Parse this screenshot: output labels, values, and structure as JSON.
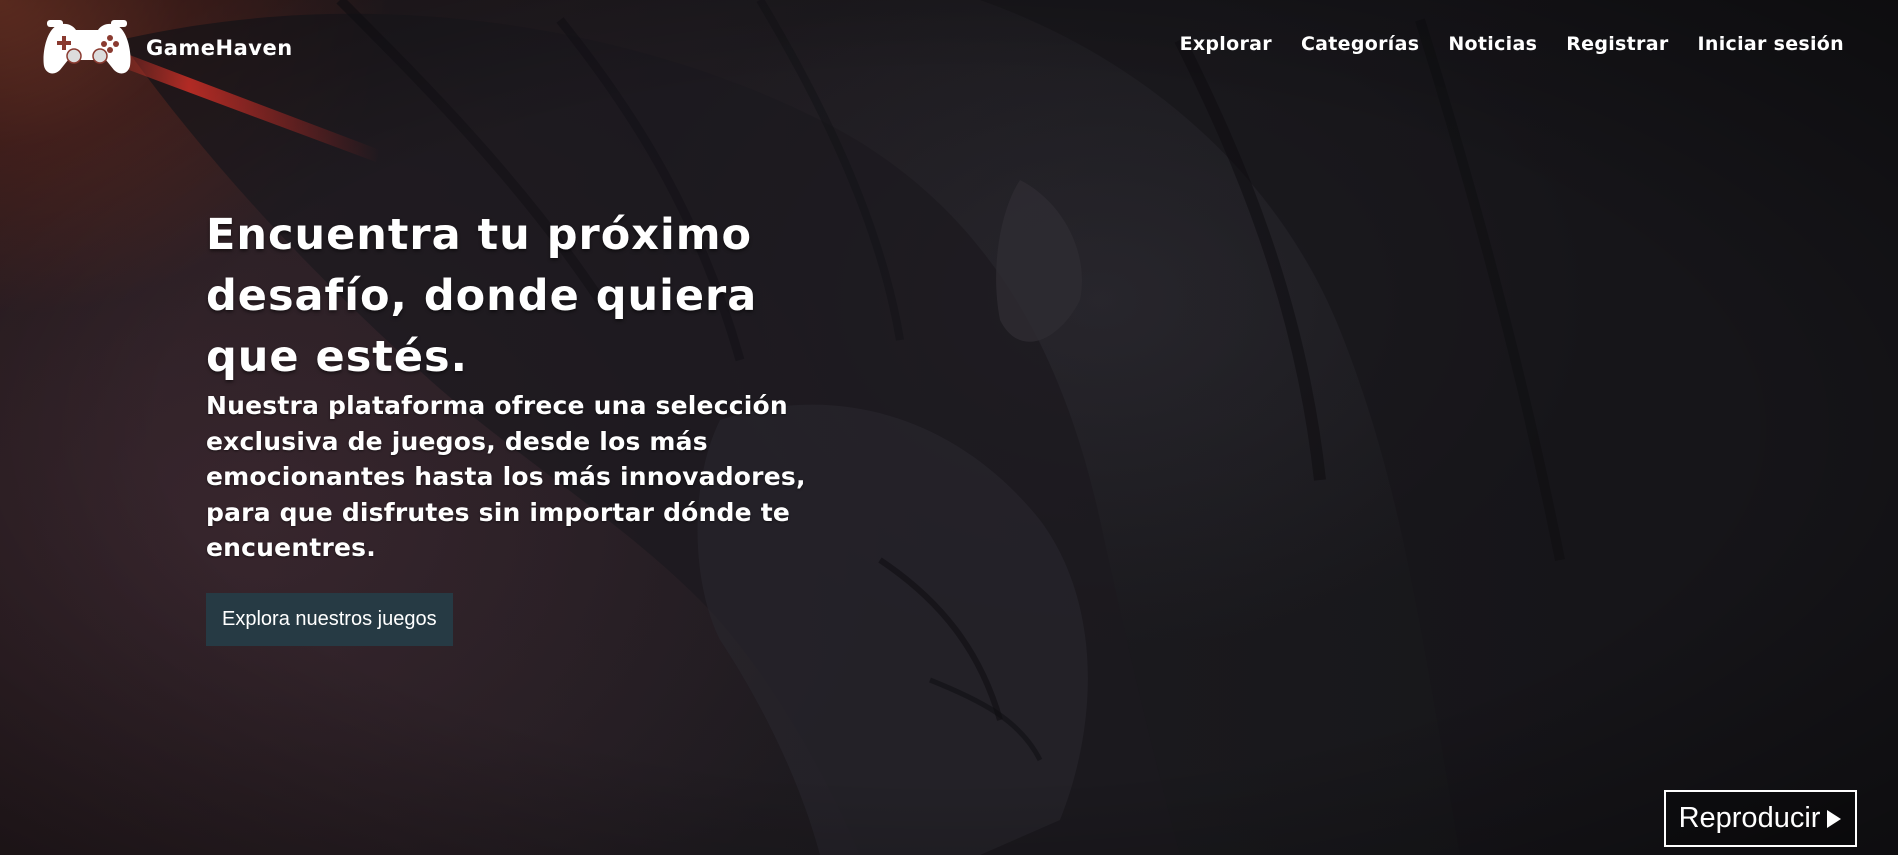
{
  "brand": {
    "name": "GameHaven",
    "logo_icon": "gamepad-icon"
  },
  "nav": {
    "items": [
      {
        "label": "Explorar"
      },
      {
        "label": "Categorías"
      },
      {
        "label": "Noticias"
      },
      {
        "label": "Registrar"
      },
      {
        "label": "Iniciar sesión"
      }
    ]
  },
  "hero": {
    "headline": "Encuentra tu próximo desafío, donde quiera que estés.",
    "subtext": "Nuestra plataforma ofrece una selección exclusiva de juegos, desde los más emocionantes hasta los más innovadores, para que disfrutes sin importar dónde te encuentres.",
    "cta_label": "Explora nuestros juegos",
    "play_label": "Reproducir",
    "play_icon": "play-icon"
  },
  "colors": {
    "cta_background": "#263a44",
    "text": "#ffffff",
    "accent_glow": "#c0312a"
  }
}
